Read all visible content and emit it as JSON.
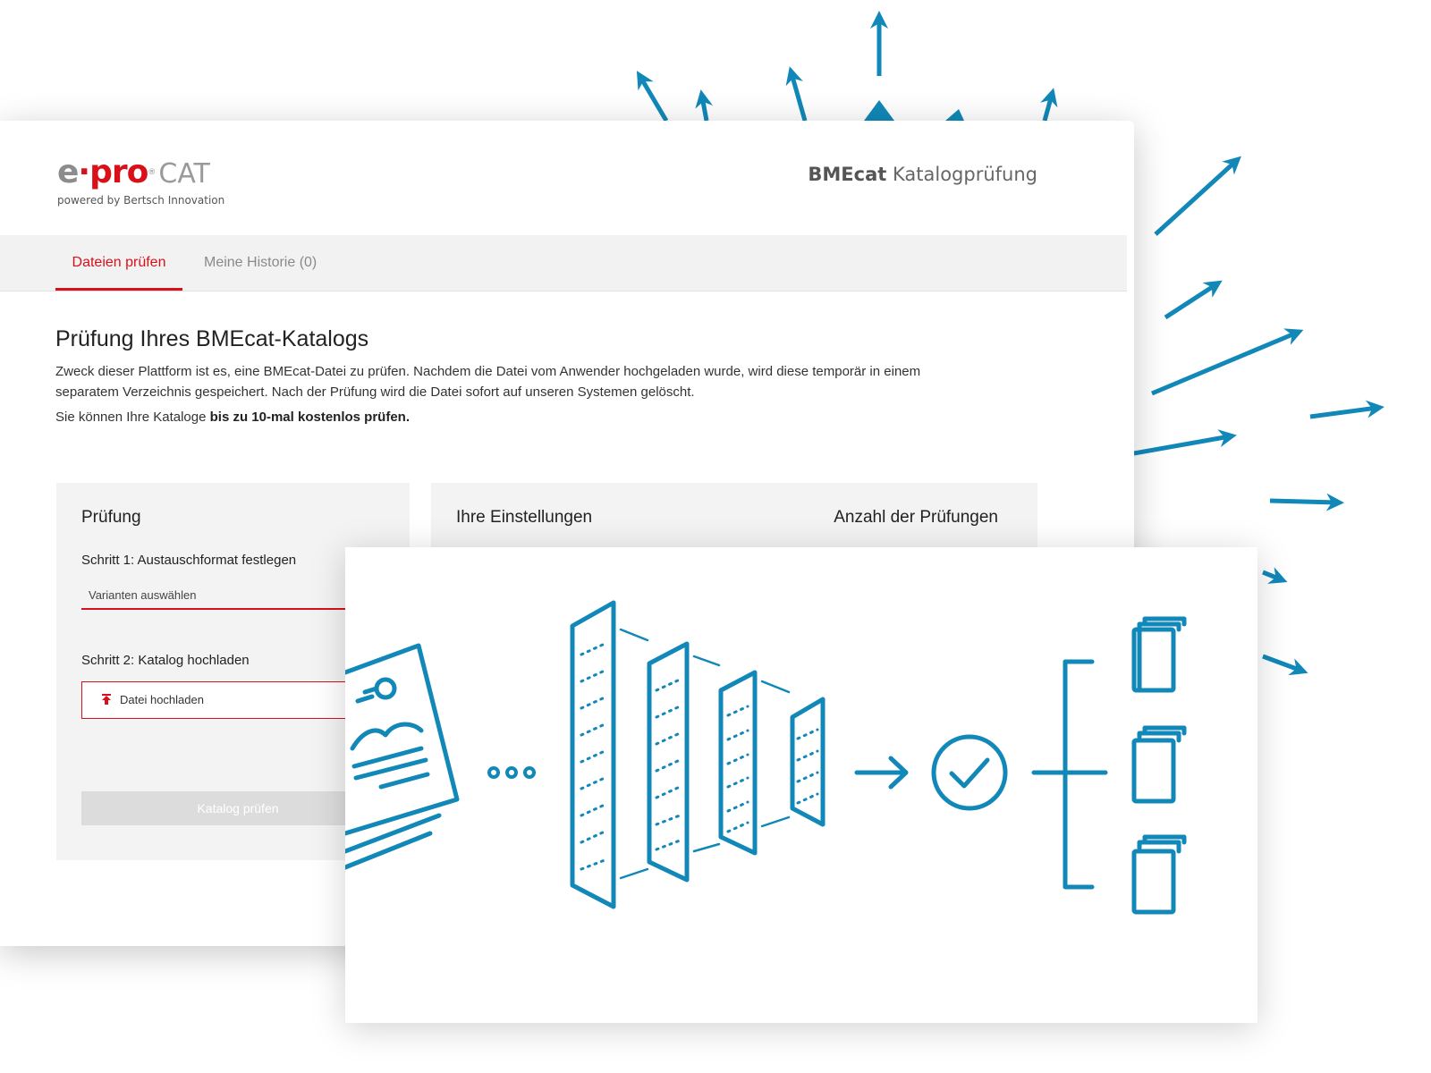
{
  "colors": {
    "brand_red": "#d9101a",
    "accent_blue": "#1188b8",
    "logo_gray": "#8c8c8c"
  },
  "logo": {
    "e": "e",
    "dot": "·",
    "pro": "pro",
    "reg": "®",
    "cat": "CAT",
    "subtitle": "powered by Bertsch Innovation"
  },
  "header": {
    "title_bold": "BMEcat",
    "title_light": "Katalogprüfung"
  },
  "tabs": [
    {
      "label": "Dateien prüfen",
      "active": true
    },
    {
      "label": "Meine Historie (0)",
      "active": false
    }
  ],
  "main": {
    "title": "Prüfung Ihres BMEcat-Katalogs",
    "intro": "Zweck dieser Plattform ist es, eine BMEcat-Datei zu prüfen. Nachdem die Datei vom Anwender hochgeladen wurde, wird diese temporär in einem separatem Verzeichnis gespeichert. Nach der Prüfung wird die Datei sofort auf unseren Systemen gelöscht.",
    "note_prefix": "Sie können Ihre Kataloge ",
    "note_bold": "bis zu 10-mal kostenlos prüfen."
  },
  "pruefung": {
    "title": "Prüfung",
    "step1_label": "Schritt 1: Austauschformat festlegen",
    "select_value": "Varianten auswählen",
    "step2_label": "Schritt 2: Katalog hochladen",
    "upload_label": "Datei hochladen",
    "check_label": "Katalog prüfen"
  },
  "settings": {
    "title": "Ihre Einstellungen",
    "count_title": "Anzahl der Prüfungen"
  },
  "illustration": {
    "icons": [
      "document-icon",
      "ellipsis-icon",
      "filter-layer-icon",
      "arrow-right-icon",
      "checkmark-circle-icon",
      "tree-bracket-icon",
      "file-stack-icon"
    ]
  }
}
